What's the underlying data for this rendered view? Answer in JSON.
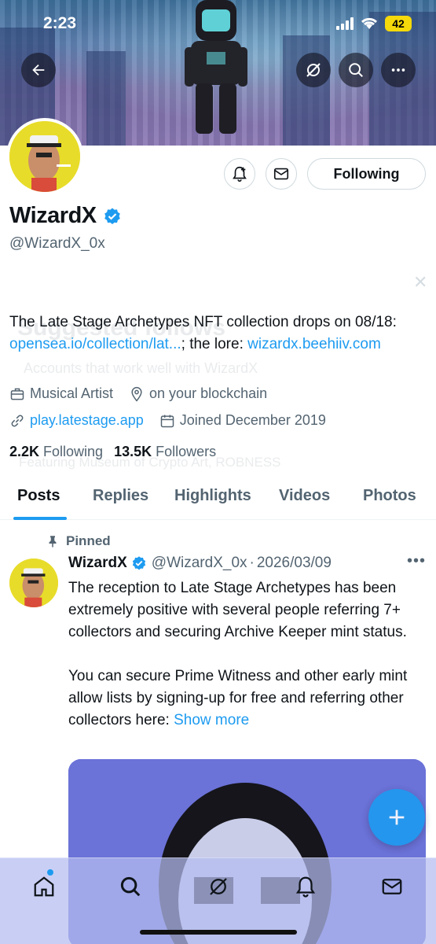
{
  "status_bar": {
    "time": "2:23",
    "battery": "42"
  },
  "profile": {
    "name": "WizardX",
    "handle": "@WizardX_0x",
    "following_button_label": "Following",
    "bio_text_1": "The Late Stage Archetypes NFT collection drops on 08/18: ",
    "bio_link_1": "opensea.io/collection/lat...",
    "bio_text_2": "; the lore: ",
    "bio_link_2": "wizardx.beehiiv.com",
    "category": "Musical Artist",
    "location": "on your blockchain",
    "website": "play.latestage.app",
    "joined": "Joined December 2019",
    "following_count": "2.2K",
    "following_label": "Following",
    "followers_count": "13.5K",
    "followers_label": "Followers"
  },
  "ghost_overlay": {
    "title": "Suggested follows",
    "subtitle": "Accounts that work well with WizardX",
    "featuring": "Featuring Museum of Crypto Art, ROBNESS"
  },
  "tabs": [
    "Posts",
    "Replies",
    "Highlights",
    "Videos",
    "Photos"
  ],
  "post": {
    "pinned_label": "Pinned",
    "author_name": "WizardX",
    "author_handle": "@WizardX_0x",
    "separator": "·",
    "date": "2026/03/09",
    "paragraph_1": "The reception to Late Stage Archetypes has been extremely positive with several people referring 7+ collectors and securing Archive Keeper mint status.",
    "paragraph_2": "You can secure Prime Witness and other early mint allow lists by signing-up for free and referring other collectors here: ",
    "show_more": "Show more"
  },
  "icons": {
    "back": "arrow-left-icon",
    "grok": "grok-icon",
    "search": "search-icon",
    "more": "more-icon",
    "notify": "bell-plus-icon",
    "message": "envelope-icon",
    "verified": "verified-badge-icon",
    "compose": "plus-icon",
    "home": "home-icon",
    "communities": "people-icon"
  },
  "colors": {
    "accent": "#1d9bf0",
    "text": "#0f1419",
    "muted": "#536471"
  }
}
